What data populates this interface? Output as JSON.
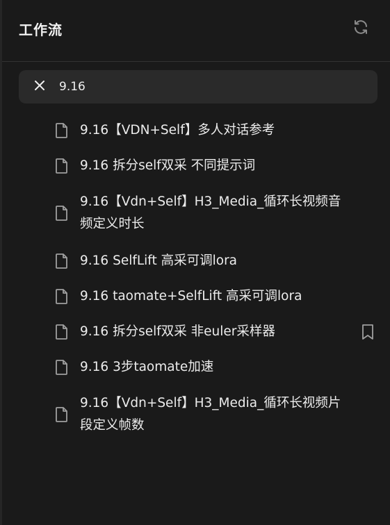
{
  "header": {
    "title": "工作流",
    "refresh_icon": "refresh-icon"
  },
  "search": {
    "value": "9.16",
    "clear_icon": "close-icon"
  },
  "items": [
    {
      "label": "9.16【VDN+Self】多人对话参考",
      "icon": "file-icon",
      "bookmarked": false
    },
    {
      "label": "9.16 拆分self双采 不同提示词",
      "icon": "file-icon",
      "bookmarked": false
    },
    {
      "label": "9.16【Vdn+Self】H3_Media_循环长视频音频定义时长",
      "icon": "file-icon",
      "bookmarked": false
    },
    {
      "label": "9.16 SelfLift 高采可调lora",
      "icon": "file-icon",
      "bookmarked": false
    },
    {
      "label": "9.16 taomate+SelfLift 高采可调lora",
      "icon": "file-icon",
      "bookmarked": false
    },
    {
      "label": "9.16 拆分self双采 非euler采样器",
      "icon": "file-icon",
      "bookmarked": true
    },
    {
      "label": "9.16 3步taomate加速",
      "icon": "file-icon",
      "bookmarked": false
    },
    {
      "label": "9.16【Vdn+Self】H3_Media_循环长视频片段定义帧数",
      "icon": "file-icon",
      "bookmarked": false
    }
  ],
  "colors": {
    "background": "#1a1a1a",
    "search_bg": "#2a2a2a",
    "text": "#ececec",
    "icon": "#a0a0a0"
  }
}
